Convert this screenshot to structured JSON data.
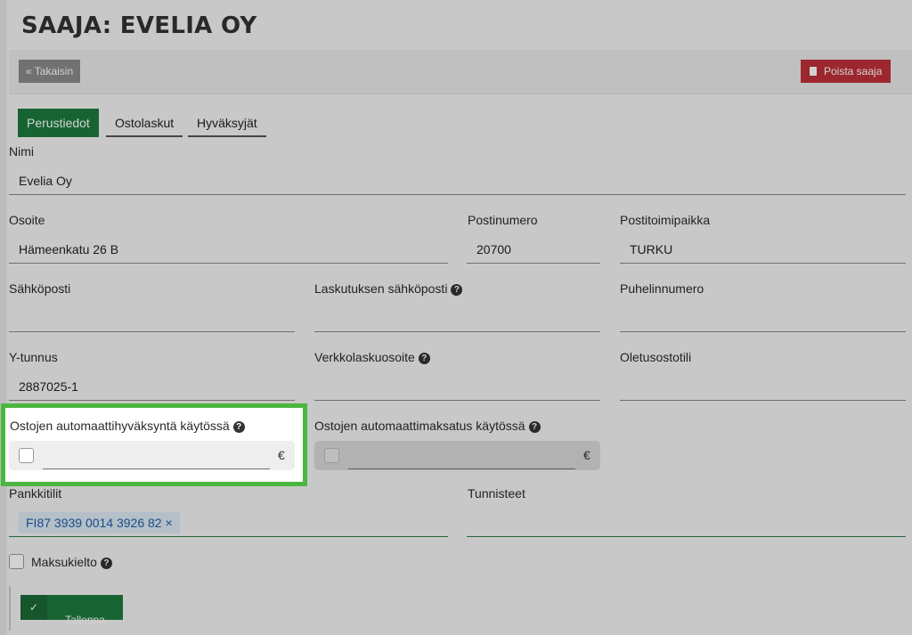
{
  "title": "SAAJA: EVELIA OY",
  "toolbar": {
    "back_label": "« Takaisin",
    "delete_label": "Poista saaja"
  },
  "tabs": [
    {
      "label": "Perustiedot"
    },
    {
      "label": "Ostolaskut"
    },
    {
      "label": "Hyväksyjät"
    }
  ],
  "form": {
    "nimi_label": "Nimi",
    "nimi_value": "Evelia Oy",
    "osoite_label": "Osoite",
    "osoite_value": "Hämeenkatu 26 B",
    "postinumero_label": "Postinumero",
    "postinumero_value": "20700",
    "postitoimipaikka_label": "Postitoimipaikka",
    "postitoimipaikka_value": "TURKU",
    "sahkoposti_label": "Sähköposti",
    "laskutus_email_label": "Laskutuksen sähköposti",
    "puhelin_label": "Puhelinnumero",
    "ytunnus_label": "Y-tunnus",
    "ytunnus_value": "2887025-1",
    "verkkolasku_label": "Verkkolaskuosoite",
    "oletustili_label": "Oletusostotili",
    "auto_approval_label": "Ostojen automaattihyväksyntä käytössä",
    "auto_payment_label": "Ostojen automaattimaksatus käytössä",
    "currency": "€",
    "pankkitilit_label": "Pankkitilit",
    "pankkitili_tag": "FI87 3939 0014 3926 82 ×",
    "tunnisteet_label": "Tunnisteet",
    "maksukielto_label": "Maksukielto"
  },
  "save_label": "Tallenna",
  "icons": {
    "help": "?",
    "check": "✓",
    "trash": "trash-icon"
  },
  "colors": {
    "primary": "#1d7a3e",
    "danger": "#c0303a",
    "highlight": "#4bb63f",
    "tag": "#1f5fa8"
  }
}
